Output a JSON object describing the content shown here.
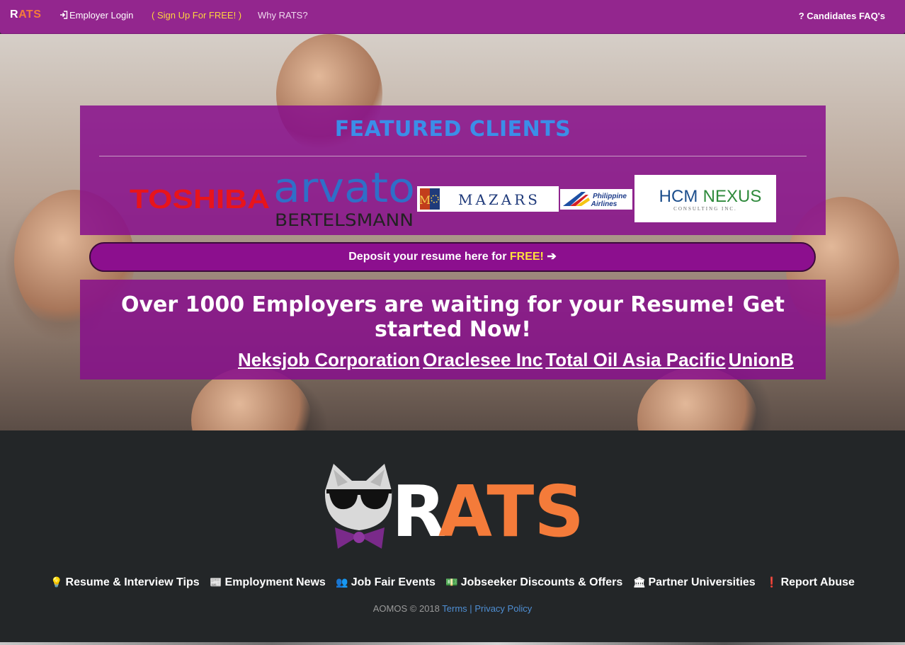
{
  "navbar": {
    "brand_first": "R",
    "brand_rest": "ATS",
    "employer_login": "Employer Login",
    "signup": "( Sign Up For FREE! )",
    "why": "Why RATS?",
    "faq": "? Candidates FAQ's"
  },
  "featured": {
    "title": "FEATURED CLIENTS",
    "logos": {
      "toshiba": "TOSHIBA",
      "arvato_main": "arvato",
      "arvato_sub": "BERTELSMANN",
      "mazars": "MAZARS",
      "mazars_letter": "M",
      "pal_line1": "Philippine",
      "pal_line2": "Airlines",
      "hcm_a": "HCM",
      "hcm_b": "NEXUS",
      "hcm_sub": "CONSULTING INC."
    }
  },
  "deposit": {
    "text_prefix": "Deposit your resume here for ",
    "text_free": "FREE!",
    "arrow": "➔"
  },
  "cta": {
    "headline": "Over 1000 Employers are waiting for your Resume! Get started Now!",
    "companies": [
      "Neksjob Corporation",
      "Oraclesee Inc",
      "Total Oil Asia Pacific",
      "UnionB"
    ]
  },
  "footer": {
    "logo_r": "R",
    "logo_ats": "ATS",
    "links": [
      {
        "icon": "💡",
        "label": "Resume & Interview Tips"
      },
      {
        "icon": "📰",
        "label": "Employment News"
      },
      {
        "icon": "👥",
        "label": "Job Fair Events"
      },
      {
        "icon": "💵",
        "label": "Jobseeker Discounts & Offers"
      },
      {
        "icon": "🏛",
        "label": "Partner Universities"
      },
      {
        "icon": "❗",
        "label": "Report Abuse"
      }
    ],
    "copyright": "AOMOS © 2018",
    "terms": "Terms",
    "separator": "|",
    "privacy": "Privacy Policy"
  },
  "colors": {
    "nav_bg": "#93268e",
    "panel_bg": "#870e8c",
    "accent_orange": "#f47b3a",
    "accent_yellow": "#ffe23c",
    "featured_title": "#3b8ee8",
    "footer_bg": "#232628",
    "link_blue": "#4f8fd4"
  }
}
